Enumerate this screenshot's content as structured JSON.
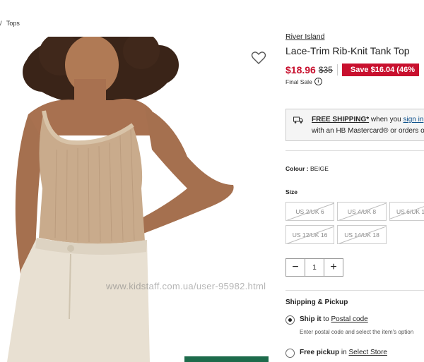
{
  "breadcrumb": {
    "separator": "/",
    "current": "Tops"
  },
  "product": {
    "brand": "River Island",
    "title": "Lace-Trim Rib-Knit Tank Top",
    "sale_price": "$18.96",
    "original_price": "$35",
    "save_badge": "Save $16.04 (46%",
    "final_sale": "Final Sale"
  },
  "shipping_banner": {
    "free_shipping": "FREE SHIPPING*",
    "when_you": " when you ",
    "sign_in": "sign in",
    "line2": "with an HB Mastercard® or orders o"
  },
  "colour": {
    "label": "Colour :",
    "value": "BEIGE"
  },
  "size": {
    "label": "Size",
    "options": [
      "US 2/UK 6",
      "US 4/UK 8",
      "US 6/UK 1",
      "US 12/UK 16",
      "US 14/UK 18"
    ]
  },
  "quantity": {
    "minus": "−",
    "value": "1",
    "plus": "+"
  },
  "shipping_pickup": {
    "title": "Shipping & Pickup",
    "ship_prefix": "Ship it",
    "ship_to": " to ",
    "postal_link": "Postal code",
    "ship_sub": "Enter postal code and select the item's option",
    "pickup_prefix": "Free pickup",
    "pickup_in": " in ",
    "store_link": "Select Store"
  },
  "watermark": "www.kidstaff.com.ua/user-95982.html",
  "colors": {
    "accent_red": "#c8102e",
    "green_button": "#1d6b4b"
  },
  "icons": [
    "heart-icon",
    "truck-icon",
    "info-icon",
    "minus-icon",
    "plus-icon"
  ]
}
